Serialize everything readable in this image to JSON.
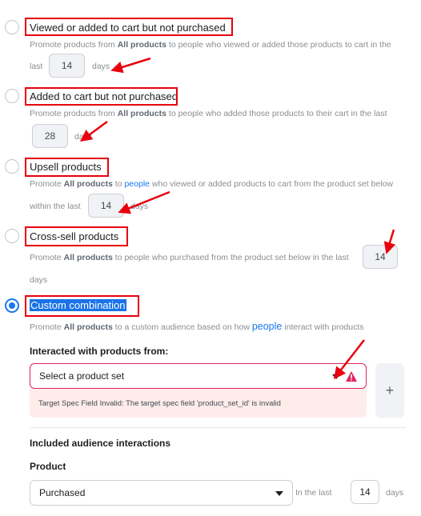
{
  "options": [
    {
      "title": "Viewed or added to cart but not purchased",
      "desc_pre": "Promote products from ",
      "desc_bold": "All products",
      "desc_post": " to people who viewed or added those products to cart in the",
      "line2_pre": "last",
      "days_value": "14",
      "days_label": "days",
      "selected": false
    },
    {
      "title": "Added to cart but not purchased",
      "desc_pre": "Promote products from ",
      "desc_bold": "All products",
      "desc_post": " to people who added those products to their cart in the last",
      "days_value": "28",
      "days_label": "days",
      "selected": false
    },
    {
      "title": "Upsell products",
      "desc_pre": "Promote ",
      "desc_bold": "All products",
      "desc_mid": " to ",
      "desc_link": "people",
      "desc_post": " who viewed or added products to cart from the product set below",
      "line2_pre": "within the last",
      "days_value": "14",
      "days_label": "days",
      "selected": false
    },
    {
      "title": "Cross-sell products",
      "desc_pre": "Promote ",
      "desc_bold": "All products",
      "desc_post": " to people who purchased from the product set below in the last",
      "days_value": "14",
      "days_label": "days",
      "selected": false
    },
    {
      "title": "Custom combination",
      "desc_pre": "Promote ",
      "desc_bold": "All products",
      "desc_mid": " to a custom audience based on how ",
      "desc_link": "people",
      "desc_post": " interact with products",
      "selected": true
    }
  ],
  "interacted": {
    "heading": "Interacted with products from:",
    "select_placeholder": "Select a product set",
    "error_message": "Target Spec Field Invalid: The target spec field 'product_set_id' is invalid",
    "add_label": "+"
  },
  "included": {
    "heading": "Included audience interactions",
    "product_label": "Product",
    "event_value": "Purchased",
    "in_the_last": "In the last",
    "days_value": "14",
    "days_label": "days"
  },
  "colors": {
    "accent": "#1877f2",
    "error": "#e0245e",
    "annotation": "#e8000e"
  }
}
